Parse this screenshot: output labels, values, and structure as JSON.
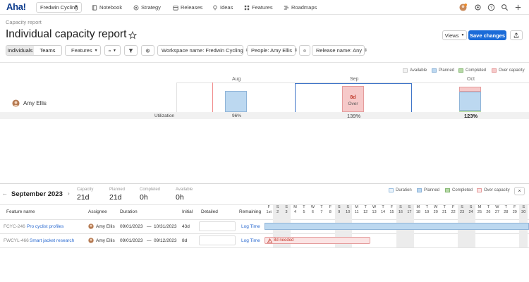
{
  "nav": {
    "logo": "Aha!",
    "workspace": "Fredwin Cycling",
    "items": [
      {
        "label": "Notebook",
        "icon": "notebook-icon"
      },
      {
        "label": "Strategy",
        "icon": "strategy-icon"
      },
      {
        "label": "Releases",
        "icon": "releases-icon"
      },
      {
        "label": "Ideas",
        "icon": "ideas-icon"
      },
      {
        "label": "Features",
        "icon": "features-icon"
      },
      {
        "label": "Roadmaps",
        "icon": "roadmaps-icon"
      }
    ]
  },
  "header": {
    "breadcrumb": "Capacity report",
    "title": "Individual capacity report",
    "views_label": "Views",
    "save_label": "Save changes"
  },
  "toolbar": {
    "tabs": [
      "Individuals",
      "Teams"
    ],
    "active_tab": "Individuals",
    "features_label": "Features",
    "filters": [
      "Workspace name: Fredwin Cycling",
      "People: Amy Ellis",
      "Release name: Any"
    ]
  },
  "chart": {
    "legend": [
      {
        "label": "Available",
        "color": "#eeeeee"
      },
      {
        "label": "Planned",
        "color": "#bcd8f0"
      },
      {
        "label": "Completed",
        "color": "#b6d8a6"
      },
      {
        "label": "Over capacity",
        "color": "#f6c9c9"
      }
    ],
    "months": [
      "Aug",
      "Sep",
      "Oct"
    ],
    "person": "Amy Ellis",
    "utilization_label": "Utilization",
    "utilization": [
      "96%",
      "139%",
      "123%"
    ],
    "over_value": "8d",
    "over_label": "Over"
  },
  "detail": {
    "month": "September 2023",
    "stats": [
      {
        "label": "Capacity",
        "value": "21d"
      },
      {
        "label": "Planned",
        "value": "21d"
      },
      {
        "label": "Completed",
        "value": "0h"
      },
      {
        "label": "Available",
        "value": "0h"
      }
    ],
    "legend": [
      "Duration",
      "Planned",
      "Completed",
      "Over capacity"
    ],
    "columns": [
      "Feature name",
      "Assignee",
      "Duration",
      "Initial",
      "Detailed",
      "Remaining"
    ],
    "days": [
      {
        "w": "F",
        "d": "1st"
      },
      {
        "w": "S",
        "d": "2"
      },
      {
        "w": "S",
        "d": "3"
      },
      {
        "w": "M",
        "d": "4"
      },
      {
        "w": "T",
        "d": "5"
      },
      {
        "w": "W",
        "d": "6"
      },
      {
        "w": "T",
        "d": "7"
      },
      {
        "w": "F",
        "d": "8"
      },
      {
        "w": "S",
        "d": "9"
      },
      {
        "w": "S",
        "d": "10"
      },
      {
        "w": "M",
        "d": "11"
      },
      {
        "w": "T",
        "d": "12"
      },
      {
        "w": "W",
        "d": "13"
      },
      {
        "w": "T",
        "d": "14"
      },
      {
        "w": "F",
        "d": "15"
      },
      {
        "w": "S",
        "d": "16"
      },
      {
        "w": "S",
        "d": "17"
      },
      {
        "w": "M",
        "d": "18"
      },
      {
        "w": "T",
        "d": "19"
      },
      {
        "w": "W",
        "d": "20"
      },
      {
        "w": "T",
        "d": "21"
      },
      {
        "w": "F",
        "d": "22"
      },
      {
        "w": "S",
        "d": "23"
      },
      {
        "w": "S",
        "d": "24"
      },
      {
        "w": "M",
        "d": "25"
      },
      {
        "w": "T",
        "d": "26"
      },
      {
        "w": "W",
        "d": "27"
      },
      {
        "w": "T",
        "d": "28"
      },
      {
        "w": "F",
        "d": "29"
      },
      {
        "w": "S",
        "d": "30"
      }
    ],
    "rows": [
      {
        "id": "FCYC-246",
        "name": "Pro cyclist profiles",
        "assignee": "Amy Ellis",
        "start": "09/01/2023",
        "sep": "—",
        "end": "10/31/2023",
        "initial": "43d",
        "remaining": "Log Time"
      },
      {
        "id": "FWCYL-466",
        "name": "Smart jacket research",
        "assignee": "Amy Ellis",
        "start": "09/01/2023",
        "sep": "—",
        "end": "09/12/2023",
        "initial": "8d",
        "remaining": "Log Time",
        "warning": "8d needed"
      }
    ]
  }
}
